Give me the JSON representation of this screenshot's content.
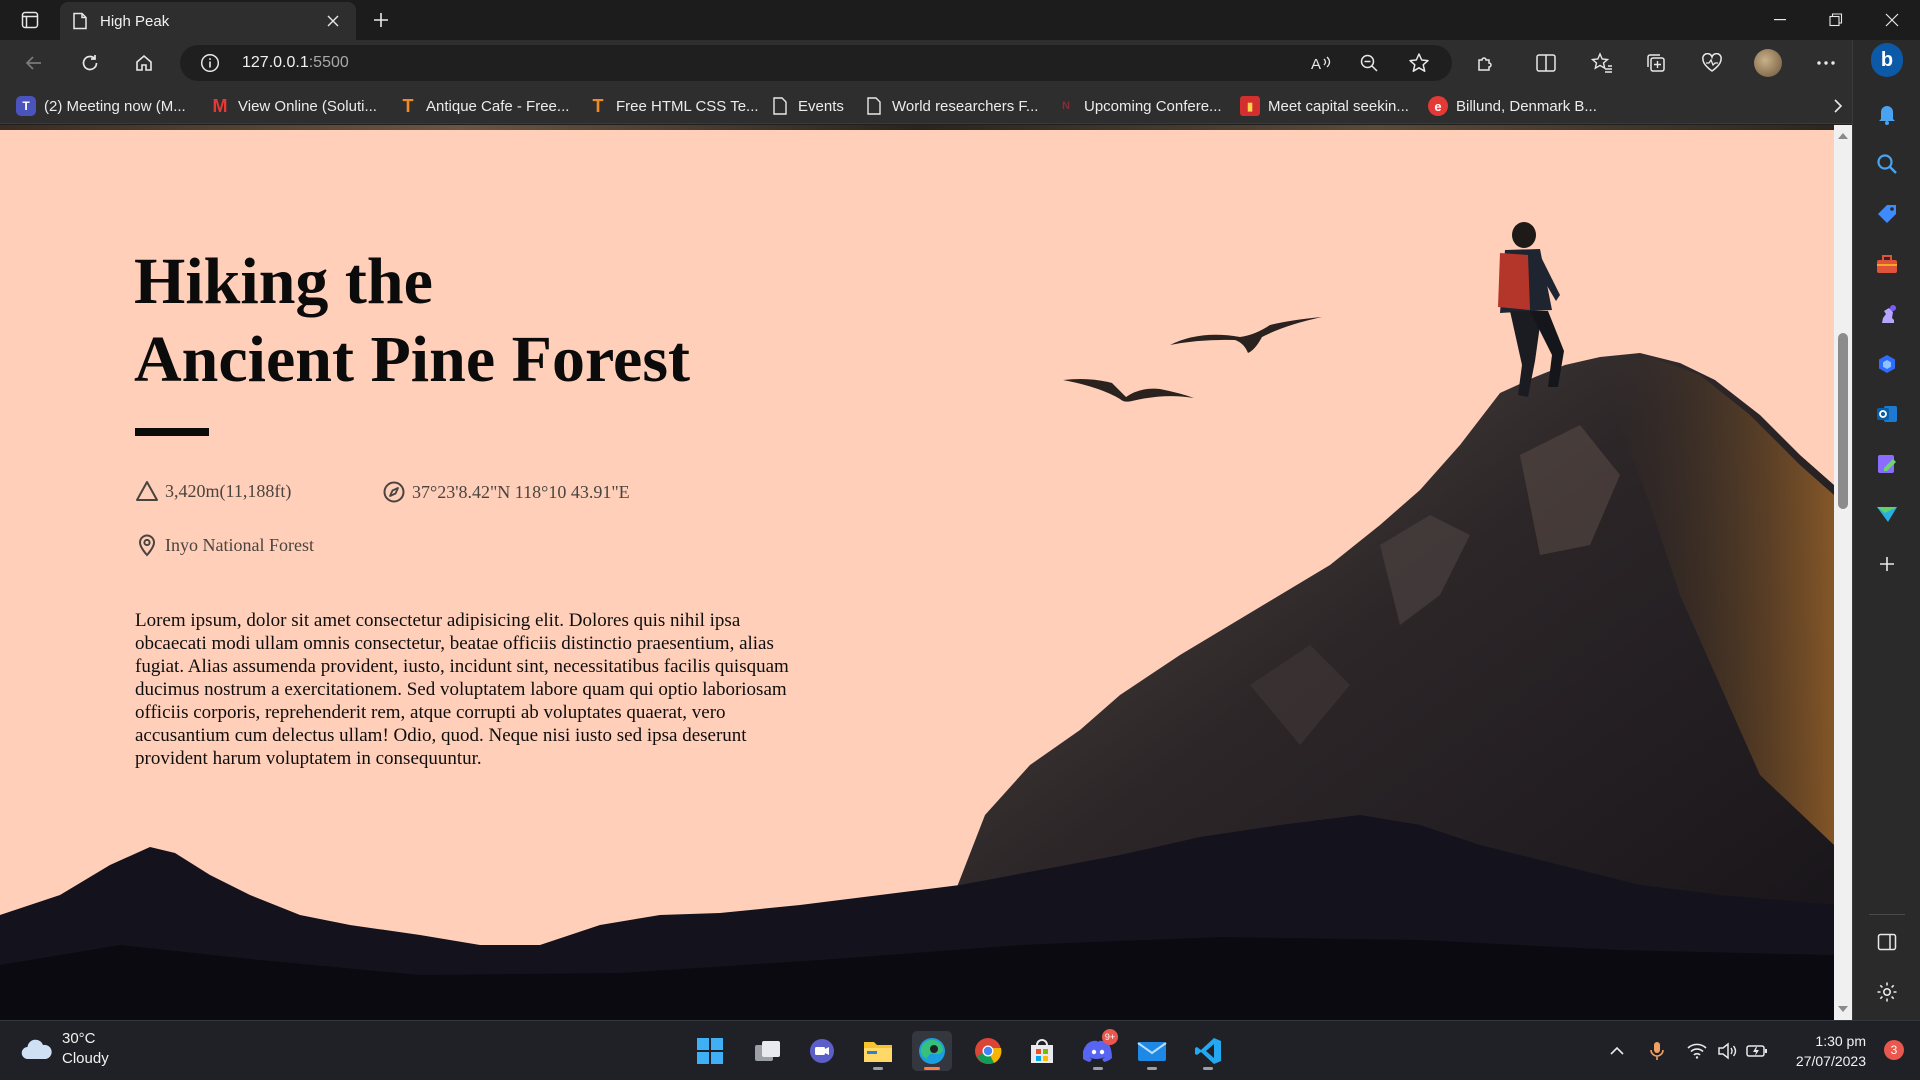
{
  "browser": {
    "tab_title": "High Peak",
    "url_host": "127.0.0.1",
    "url_port": ":5500"
  },
  "bookmarks": [
    {
      "label": "(2) Meeting now (M...",
      "icon": "teams-icon"
    },
    {
      "label": "View Online (Soluti...",
      "icon": "gmail-icon"
    },
    {
      "label": "Antique Cafe - Free...",
      "icon": "templatemo-icon"
    },
    {
      "label": "Free HTML CSS Te...",
      "icon": "templatemo-icon"
    },
    {
      "label": "Events",
      "icon": "page-icon"
    },
    {
      "label": "World researchers F...",
      "icon": "page-icon"
    },
    {
      "label": "Upcoming Confere...",
      "icon": "n-icon"
    },
    {
      "label": "Meet capital seekin...",
      "icon": "red-app-icon"
    },
    {
      "label": "Billund, Denmark B...",
      "icon": "e-icon"
    }
  ],
  "page": {
    "title_line1": "Hiking the",
    "title_line2": "Ancient Pine Forest",
    "elevation": "3,420m(11,188ft)",
    "coordinates": "37°23'8.42\"N 118°10 43.91\"E",
    "location": "Inyo National Forest",
    "body": "Lorem ipsum, dolor sit amet consectetur adipisicing elit. Dolores quis nihil ipsa obcaecati modi ullam omnis consectetur, beatae officiis distinctio praesentium, alias fugiat. Alias assumenda provident, iusto, incidunt sint, necessitatibus facilis quisquam ducimus nostrum a exercitationem. Sed voluptatem labore quam qui optio laboriosam officiis corporis, reprehenderit rem, atque corrupti ab voluptates quaerat, vero accusantium cum delectus ullam! Odio, quod. Neque nisi iusto sed ipsa deserunt provident harum voluptatem in consequuntur."
  },
  "taskbar": {
    "temperature": "30°C",
    "condition": "Cloudy",
    "time": "1:30 pm",
    "date": "27/07/2023",
    "notifications": "3",
    "discord_badge": "9+"
  },
  "colors": {
    "page_background": "#ffcfb9",
    "mountain_dark": "#0e0d14",
    "accent_edge": "#ff7a4d"
  }
}
